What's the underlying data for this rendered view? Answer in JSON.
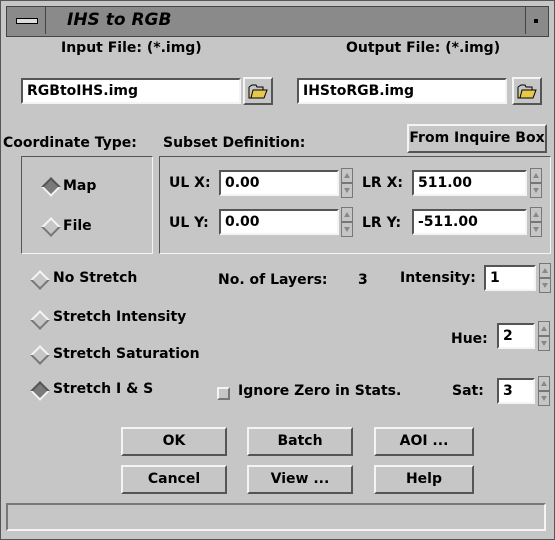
{
  "window": {
    "title": "IHS to RGB"
  },
  "input": {
    "label": "Input File: (*.img)",
    "value": "RGBtoIHS.img"
  },
  "output": {
    "label": "Output File: (*.img)",
    "value": "IHStoRGB.img"
  },
  "coordinate": {
    "label": "Coordinate Type:",
    "options": [
      "Map",
      "File"
    ],
    "selected": "Map"
  },
  "subset": {
    "label": "Subset Definition:",
    "inquire_button": "From Inquire Box",
    "ulx_label": "UL X:",
    "ulx": "0.00",
    "lrx_label": "LR X:",
    "lrx": "511.00",
    "uly_label": "UL Y:",
    "uly": "0.00",
    "lry_label": "LR Y:",
    "lry": "-511.00"
  },
  "stretch": {
    "options": [
      "No Stretch",
      "Stretch Intensity",
      "Stretch Saturation",
      "Stretch I & S"
    ],
    "selected": "Stretch I & S"
  },
  "layers": {
    "label": "No. of Layers:",
    "value": "3"
  },
  "intensity": {
    "label": "Intensity:",
    "value": "1"
  },
  "hue": {
    "label": "Hue:",
    "value": "2"
  },
  "sat": {
    "label": "Sat:",
    "value": "3"
  },
  "ignore_zero": {
    "label": "Ignore Zero in Stats.",
    "checked": false
  },
  "buttons": {
    "ok": "OK",
    "batch": "Batch",
    "aoi": "AOI ...",
    "cancel": "Cancel",
    "view": "View ...",
    "help": "Help"
  },
  "status": {
    "text": ""
  }
}
